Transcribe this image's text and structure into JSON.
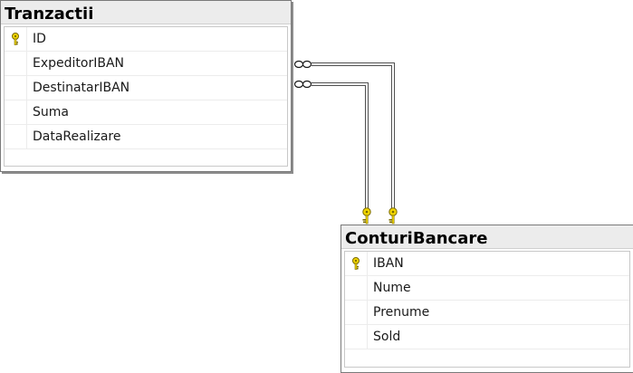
{
  "tables": {
    "tranzactii": {
      "title": "Tranzactii",
      "columns": [
        {
          "name": "ID",
          "primary_key": true
        },
        {
          "name": "ExpeditorIBAN",
          "primary_key": false
        },
        {
          "name": "DestinatarIBAN",
          "primary_key": false
        },
        {
          "name": "Suma",
          "primary_key": false
        },
        {
          "name": "DataRealizare",
          "primary_key": false
        }
      ]
    },
    "conturi_bancare": {
      "title": "ConturiBancare",
      "columns": [
        {
          "name": "IBAN",
          "primary_key": true
        },
        {
          "name": "Nume",
          "primary_key": false
        },
        {
          "name": "Prenume",
          "primary_key": false
        },
        {
          "name": "Sold",
          "primary_key": false
        }
      ]
    }
  },
  "relationships": [
    {
      "from_table": "Tranzactii",
      "from_column": "ExpeditorIBAN",
      "to_table": "ConturiBancare",
      "to_column": "IBAN",
      "many_end": "infinity-icon",
      "one_end": "key-icon"
    },
    {
      "from_table": "Tranzactii",
      "from_column": "DestinatarIBAN",
      "to_table": "ConturiBancare",
      "to_column": "IBAN",
      "many_end": "infinity-icon",
      "one_end": "key-icon"
    }
  ],
  "colors": {
    "key_fill": "#f2d600",
    "key_stroke": "#7a6a00",
    "line": "#505050",
    "title_bg": "#ececec"
  }
}
